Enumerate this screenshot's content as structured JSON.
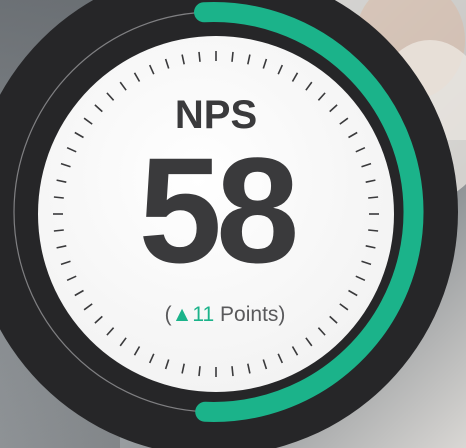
{
  "gauge": {
    "title": "NPS",
    "value": "58",
    "change": {
      "open": "(",
      "arrow": "▲",
      "amount": "11",
      "unit": " Points)"
    },
    "level": 0.58
  },
  "colors": {
    "accent": "#1bb38a",
    "dial_text": "#3a3a3c",
    "dark_ring": "#262628",
    "dial_face": "#ffffff",
    "tick": "#3a3a3c"
  },
  "background": {
    "description_icon": "office-photo"
  }
}
